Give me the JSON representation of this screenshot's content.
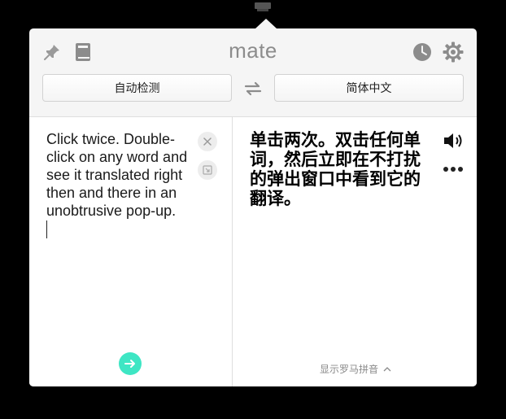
{
  "app": {
    "title": "mate"
  },
  "toolbar": {
    "source_language": "自动检测",
    "target_language": "简体中文",
    "icons": [
      "pin-icon",
      "book-icon",
      "history-icon",
      "gear-icon",
      "swap-icon"
    ]
  },
  "source": {
    "text": "Click twice. Double-click on any word and see it translated right then and there in an unobtrusive pop-up."
  },
  "translation": {
    "text": "单击两次。双击任何单词，然后立即在不打扰的弹出窗口中看到它的翻译。",
    "romanization_label": "显示罗马拼音"
  },
  "colors": {
    "accent": "#3ee6c4",
    "icon_gray": "#8c8c8c",
    "panel_bg": "#f5f5f5"
  }
}
